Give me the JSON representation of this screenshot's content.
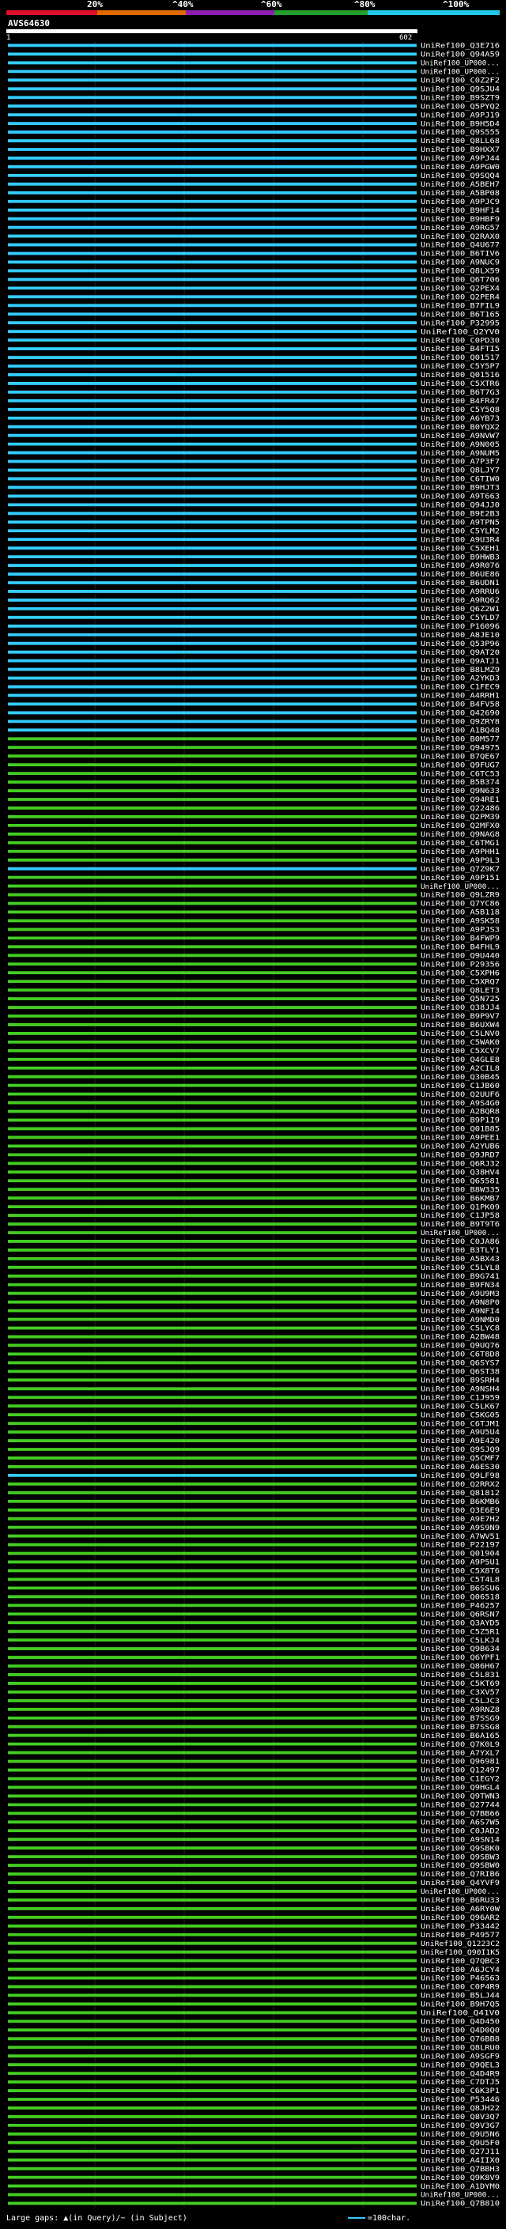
{
  "scale": {
    "labels": [
      "20%",
      "^40%",
      "^60%",
      "^80%",
      "^100%"
    ],
    "colors": [
      "#e0102a",
      "#e06a00",
      "#8a1fb0",
      "#22a02a",
      "#22c8e8"
    ]
  },
  "query": {
    "name": "AVS64630",
    "start": "1",
    "end": "602"
  },
  "colors": {
    "cyan": "#33ccff",
    "green": "#44cc22",
    "query_bar": "#ffffff"
  },
  "rows": [
    {
      "label": "UniRef100_Q3E716",
      "color": "cyan"
    },
    {
      "label": "UniRef100_Q94A59",
      "color": "cyan"
    },
    {
      "label": "UniRef100_UP000...",
      "color": "cyan"
    },
    {
      "label": "UniRef100_UP000...",
      "color": "cyan"
    },
    {
      "label": "UniRef100_C0Z2F2",
      "color": "cyan"
    },
    {
      "label": "UniRef100_Q9SJU4",
      "color": "cyan"
    },
    {
      "label": "UniRef100_B9SZT9",
      "color": "cyan"
    },
    {
      "label": "UniRef100_Q5PYQ2",
      "color": "cyan"
    },
    {
      "label": "UniRef100_A9PJ19",
      "color": "cyan"
    },
    {
      "label": "UniRef100_B9H5D4",
      "color": "cyan"
    },
    {
      "label": "UniRef100_Q9S555",
      "color": "cyan"
    },
    {
      "label": "UniRef100_Q8LL68",
      "color": "cyan"
    },
    {
      "label": "UniRef100_B9HXX7",
      "color": "cyan"
    },
    {
      "label": "UniRef100_A9PJ44",
      "color": "cyan"
    },
    {
      "label": "UniRef100_A9PGW0",
      "color": "cyan"
    },
    {
      "label": "UniRef100_Q9SQQ4",
      "color": "cyan"
    },
    {
      "label": "UniRef100_A5BEH7",
      "color": "cyan"
    },
    {
      "label": "UniRef100_A5BP08",
      "color": "cyan"
    },
    {
      "label": "UniRef100_A9PJC9",
      "color": "cyan"
    },
    {
      "label": "UniRef100_B9HF14",
      "color": "cyan"
    },
    {
      "label": "UniRef100_B9HBF9",
      "color": "cyan"
    },
    {
      "label": "UniRef100_A9RG57",
      "color": "cyan"
    },
    {
      "label": "UniRef100_Q2RAX0",
      "color": "cyan"
    },
    {
      "label": "UniRef100_Q4U677",
      "color": "cyan"
    },
    {
      "label": "UniRef100_B6TIV6",
      "color": "cyan"
    },
    {
      "label": "UniRef100_A9NUC9",
      "color": "cyan"
    },
    {
      "label": "UniRef100_Q8LX59",
      "color": "cyan"
    },
    {
      "label": "UniRef100_Q6T706",
      "color": "cyan"
    },
    {
      "label": "UniRef100_Q2PEX4",
      "color": "cyan"
    },
    {
      "label": "UniRef100_Q2PER4",
      "color": "cyan"
    },
    {
      "label": "UniRef100_B7FIL9",
      "color": "cyan"
    },
    {
      "label": "UniRef100_B6T165",
      "color": "cyan"
    },
    {
      "label": "UniRef100_P32995",
      "color": "cyan"
    },
    {
      "label": "UniRef100_Q2YV0",
      "color": "cyan"
    },
    {
      "label": "UniRef100_C0PD30",
      "color": "cyan"
    },
    {
      "label": "UniRef100_B4FTI5",
      "color": "cyan"
    },
    {
      "label": "UniRef100_Q01517",
      "color": "cyan"
    },
    {
      "label": "UniRef100_C5Y5P7",
      "color": "cyan"
    },
    {
      "label": "UniRef100_Q01516",
      "color": "cyan"
    },
    {
      "label": "UniRef100_C5XTR6",
      "color": "cyan"
    },
    {
      "label": "UniRef100_B6T7G3",
      "color": "cyan"
    },
    {
      "label": "UniRef100_B4FR47",
      "color": "cyan"
    },
    {
      "label": "UniRef100_C5Y5Q8",
      "color": "cyan"
    },
    {
      "label": "UniRef100_A6YB73",
      "color": "cyan"
    },
    {
      "label": "UniRef100_B0YQX2",
      "color": "cyan"
    },
    {
      "label": "UniRef100_A9NVW7",
      "color": "cyan"
    },
    {
      "label": "UniRef100_A9N005",
      "color": "cyan"
    },
    {
      "label": "UniRef100_A9NUM5",
      "color": "cyan"
    },
    {
      "label": "UniRef100_A7P3F7",
      "color": "cyan"
    },
    {
      "label": "UniRef100_Q8LJY7",
      "color": "cyan"
    },
    {
      "label": "UniRef100_C6TIW0",
      "color": "cyan"
    },
    {
      "label": "UniRef100_B9HJT3",
      "color": "cyan"
    },
    {
      "label": "UniRef100_A9T663",
      "color": "cyan"
    },
    {
      "label": "UniRef100_Q94JJ0",
      "color": "cyan"
    },
    {
      "label": "UniRef100_B9E2B3",
      "color": "cyan"
    },
    {
      "label": "UniRef100_A9TPN5",
      "color": "cyan"
    },
    {
      "label": "UniRef100_C5YLM2",
      "color": "cyan"
    },
    {
      "label": "UniRef100_A9U3R4",
      "color": "cyan"
    },
    {
      "label": "UniRef100_C5XEH1",
      "color": "cyan"
    },
    {
      "label": "UniRef100_B9HWB3",
      "color": "cyan"
    },
    {
      "label": "UniRef100_A9R076",
      "color": "cyan"
    },
    {
      "label": "UniRef100_B6UE86",
      "color": "cyan"
    },
    {
      "label": "UniRef100_B6UDN1",
      "color": "cyan"
    },
    {
      "label": "UniRef100_A9RRU6",
      "color": "cyan"
    },
    {
      "label": "UniRef100_A9RQ62",
      "color": "cyan"
    },
    {
      "label": "UniRef100_Q6Z2W1",
      "color": "cyan"
    },
    {
      "label": "UniRef100_C5YLD7",
      "color": "cyan"
    },
    {
      "label": "UniRef100_P16096",
      "color": "cyan"
    },
    {
      "label": "UniRef100_A8JE10",
      "color": "cyan"
    },
    {
      "label": "UniRef100_Q53P96",
      "color": "cyan"
    },
    {
      "label": "UniRef100_Q9AT20",
      "color": "cyan"
    },
    {
      "label": "UniRef100_Q9ATJ1",
      "color": "cyan"
    },
    {
      "label": "UniRef100_B8LMZ9",
      "color": "cyan"
    },
    {
      "label": "UniRef100_A2YKD3",
      "color": "cyan"
    },
    {
      "label": "UniRef100_C1FEC9",
      "color": "cyan"
    },
    {
      "label": "UniRef100_A4RRH1",
      "color": "cyan"
    },
    {
      "label": "UniRef100_B4FV58",
      "color": "cyan"
    },
    {
      "label": "UniRef100_Q42690",
      "color": "cyan"
    },
    {
      "label": "UniRef100_Q9ZRY8",
      "color": "cyan"
    },
    {
      "label": "UniRef100_A1BQ48",
      "color": "cyan"
    },
    {
      "label": "UniRef100_B0M577",
      "color": "green"
    },
    {
      "label": "UniRef100_Q94975",
      "color": "green"
    },
    {
      "label": "UniRef100_B7QE67",
      "color": "green"
    },
    {
      "label": "UniRef100_Q9FUG7",
      "color": "green"
    },
    {
      "label": "UniRef100_C6TC53",
      "color": "green"
    },
    {
      "label": "UniRef100_B5B374",
      "color": "green"
    },
    {
      "label": "UniRef100_Q9N633",
      "color": "green"
    },
    {
      "label": "UniRef100_Q94RE1",
      "color": "green"
    },
    {
      "label": "UniRef100_Q22486",
      "color": "green"
    },
    {
      "label": "UniRef100_Q2PM39",
      "color": "green"
    },
    {
      "label": "UniRef100_Q2MFX0",
      "color": "green"
    },
    {
      "label": "UniRef100_Q9NAG8",
      "color": "green"
    },
    {
      "label": "UniRef100_C6TMG1",
      "color": "green"
    },
    {
      "label": "UniRef100_A9PHH1",
      "color": "green"
    },
    {
      "label": "UniRef100_A9P9L3",
      "color": "green"
    },
    {
      "label": "UniRef100_Q7Z9K7",
      "color": "cyan"
    },
    {
      "label": "UniRef100_A9P151",
      "color": "green"
    },
    {
      "label": "UniRef100_UP000...",
      "color": "green"
    },
    {
      "label": "UniRef100_Q9LZR9",
      "color": "green"
    },
    {
      "label": "UniRef100_Q7YC86",
      "color": "green"
    },
    {
      "label": "UniRef100_A5B118",
      "color": "green"
    },
    {
      "label": "UniRef100_A9SK58",
      "color": "green"
    },
    {
      "label": "UniRef100_A9PJS3",
      "color": "green"
    },
    {
      "label": "UniRef100_B4FWP9",
      "color": "green"
    },
    {
      "label": "UniRef100_B4FHL9",
      "color": "green"
    },
    {
      "label": "UniRef100_Q9U440",
      "color": "green"
    },
    {
      "label": "UniRef100_P29356",
      "color": "green"
    },
    {
      "label": "UniRef100_C5XPH6",
      "color": "green"
    },
    {
      "label": "UniRef100_C5XRQ7",
      "color": "green"
    },
    {
      "label": "UniRef100_Q8LET3",
      "color": "green"
    },
    {
      "label": "UniRef100_Q5N725",
      "color": "green"
    },
    {
      "label": "UniRef100_Q38JJ4",
      "color": "green"
    },
    {
      "label": "UniRef100_B9P9V7",
      "color": "green"
    },
    {
      "label": "UniRef100_B6UXW4",
      "color": "green"
    },
    {
      "label": "UniRef100_C5LNV0",
      "color": "green"
    },
    {
      "label": "UniRef100_C5WAK0",
      "color": "green"
    },
    {
      "label": "UniRef100_C5XCV7",
      "color": "green"
    },
    {
      "label": "UniRef100_Q4GLE8",
      "color": "green"
    },
    {
      "label": "UniRef100_A2CIL8",
      "color": "green"
    },
    {
      "label": "UniRef100_Q30B45",
      "color": "green"
    },
    {
      "label": "UniRef100_C1JB60",
      "color": "green"
    },
    {
      "label": "UniRef100_Q2UUF6",
      "color": "green"
    },
    {
      "label": "UniRef100_A9S4G0",
      "color": "green"
    },
    {
      "label": "UniRef100_A2BQR8",
      "color": "green"
    },
    {
      "label": "UniRef100_B9P1I9",
      "color": "green"
    },
    {
      "label": "UniRef100_Q01B85",
      "color": "green"
    },
    {
      "label": "UniRef100_A9PEE1",
      "color": "green"
    },
    {
      "label": "UniRef100_A2YUB6",
      "color": "green"
    },
    {
      "label": "UniRef100_Q9JRD7",
      "color": "green"
    },
    {
      "label": "UniRef100_Q6RJ32",
      "color": "green"
    },
    {
      "label": "UniRef100_Q38HV4",
      "color": "green"
    },
    {
      "label": "UniRef100_Q65581",
      "color": "green"
    },
    {
      "label": "UniRef100_B8W335",
      "color": "green"
    },
    {
      "label": "UniRef100_B6KMB7",
      "color": "green"
    },
    {
      "label": "UniRef100_Q1PK09",
      "color": "green"
    },
    {
      "label": "UniRef100_C1JP58",
      "color": "green"
    },
    {
      "label": "UniRef100_B9T9T6",
      "color": "green"
    },
    {
      "label": "UniRef100_UP000...",
      "color": "green"
    },
    {
      "label": "UniRef100_C0JA86",
      "color": "green"
    },
    {
      "label": "UniRef100_B3TLY1",
      "color": "green"
    },
    {
      "label": "UniRef100_A5BX43",
      "color": "green"
    },
    {
      "label": "UniRef100_C5LYL8",
      "color": "green"
    },
    {
      "label": "UniRef100_B9G741",
      "color": "green"
    },
    {
      "label": "UniRef100_B9FN34",
      "color": "green"
    },
    {
      "label": "UniRef100_A9U9M3",
      "color": "green"
    },
    {
      "label": "UniRef100_A9N8P0",
      "color": "green"
    },
    {
      "label": "UniRef100_A9NFI4",
      "color": "green"
    },
    {
      "label": "UniRef100_A9NMD0",
      "color": "green"
    },
    {
      "label": "UniRef100_C5LYC8",
      "color": "green"
    },
    {
      "label": "UniRef100_A2BW48",
      "color": "green"
    },
    {
      "label": "UniRef100_Q9UQ76",
      "color": "green"
    },
    {
      "label": "UniRef100_C6T8D8",
      "color": "green"
    },
    {
      "label": "UniRef100_Q6SYS7",
      "color": "green"
    },
    {
      "label": "UniRef100_Q6ST38",
      "color": "green"
    },
    {
      "label": "UniRef100_B9SRH4",
      "color": "green"
    },
    {
      "label": "UniRef100_A9NSH4",
      "color": "green"
    },
    {
      "label": "UniRef100_C1J959",
      "color": "green"
    },
    {
      "label": "UniRef100_C5LK67",
      "color": "green"
    },
    {
      "label": "UniRef100_C5KG05",
      "color": "green"
    },
    {
      "label": "UniRef100_C6TJM1",
      "color": "green"
    },
    {
      "label": "UniRef100_A9U5U4",
      "color": "green"
    },
    {
      "label": "UniRef100_A9E420",
      "color": "green"
    },
    {
      "label": "UniRef100_Q9SJQ9",
      "color": "green"
    },
    {
      "label": "UniRef100_Q5CMF7",
      "color": "green"
    },
    {
      "label": "UniRef100_A6ES30",
      "color": "green"
    },
    {
      "label": "UniRef100_Q9LF98",
      "color": "cyan"
    },
    {
      "label": "UniRef100_Q2RRX2",
      "color": "green"
    },
    {
      "label": "UniRef100_Q81812",
      "color": "green"
    },
    {
      "label": "UniRef100_B6KMB6",
      "color": "green"
    },
    {
      "label": "UniRef100_Q3E6E9",
      "color": "green"
    },
    {
      "label": "UniRef100_A9E7H2",
      "color": "green"
    },
    {
      "label": "UniRef100_A9S9N9",
      "color": "green"
    },
    {
      "label": "UniRef100_A7WV51",
      "color": "green"
    },
    {
      "label": "UniRef100_P22197",
      "color": "green"
    },
    {
      "label": "UniRef100_Q01904",
      "color": "green"
    },
    {
      "label": "UniRef100_A9P5U1",
      "color": "green"
    },
    {
      "label": "UniRef100_C5X8T6",
      "color": "green"
    },
    {
      "label": "UniRef100_C5T4L8",
      "color": "green"
    },
    {
      "label": "UniRef100_B6SSU6",
      "color": "green"
    },
    {
      "label": "UniRef100_Q06518",
      "color": "green"
    },
    {
      "label": "UniRef100_P46257",
      "color": "green"
    },
    {
      "label": "UniRef100_Q6RSN7",
      "color": "green"
    },
    {
      "label": "UniRef100_Q3AYD5",
      "color": "green"
    },
    {
      "label": "UniRef100_C5Z5R1",
      "color": "green"
    },
    {
      "label": "UniRef100_C5LKJ4",
      "color": "green"
    },
    {
      "label": "UniRef100_Q9B634",
      "color": "green"
    },
    {
      "label": "UniRef100_Q6YPF1",
      "color": "green"
    },
    {
      "label": "UniRef100_Q86H67",
      "color": "green"
    },
    {
      "label": "UniRef100_C5L831",
      "color": "green"
    },
    {
      "label": "UniRef100_C5KT69",
      "color": "green"
    },
    {
      "label": "UniRef100_C3XV57",
      "color": "green"
    },
    {
      "label": "UniRef100_C5LJC3",
      "color": "green"
    },
    {
      "label": "UniRef100_A9RNZ8",
      "color": "green"
    },
    {
      "label": "UniRef100_B7SSG9",
      "color": "green"
    },
    {
      "label": "UniRef100_B7SSG8",
      "color": "green"
    },
    {
      "label": "UniRef100_B6A165",
      "color": "green"
    },
    {
      "label": "UniRef100_Q7K0L9",
      "color": "green"
    },
    {
      "label": "UniRef100_A7YXL7",
      "color": "green"
    },
    {
      "label": "UniRef100_Q96981",
      "color": "green"
    },
    {
      "label": "UniRef100_Q12497",
      "color": "green"
    },
    {
      "label": "UniRef100_C1EGY2",
      "color": "green"
    },
    {
      "label": "UniRef100_Q9HGL4",
      "color": "green"
    },
    {
      "label": "UniRef100_Q9TWN3",
      "color": "green"
    },
    {
      "label": "UniRef100_Q27744",
      "color": "green"
    },
    {
      "label": "UniRef100_Q7BB66",
      "color": "green"
    },
    {
      "label": "UniRef100_A6S7W5",
      "color": "green"
    },
    {
      "label": "UniRef100_C0JAD2",
      "color": "green"
    },
    {
      "label": "UniRef100_A9SN14",
      "color": "green"
    },
    {
      "label": "UniRef100_Q9SBK0",
      "color": "green"
    },
    {
      "label": "UniRef100_Q9SBW3",
      "color": "green"
    },
    {
      "label": "UniRef100_Q9SBW0",
      "color": "green"
    },
    {
      "label": "UniRef100_Q7RIB6",
      "color": "green"
    },
    {
      "label": "UniRef100_Q4YVF9",
      "color": "green"
    },
    {
      "label": "UniRef100_UP000...",
      "color": "green"
    },
    {
      "label": "UniRef100_B6RU33",
      "color": "green"
    },
    {
      "label": "UniRef100_A6RY0W",
      "color": "green"
    },
    {
      "label": "UniRef100_Q96AR2",
      "color": "green"
    },
    {
      "label": "UniRef100_P33442",
      "color": "green"
    },
    {
      "label": "UniRef100_P49577",
      "color": "green"
    },
    {
      "label": "UniRef100_Q1223C2",
      "color": "green"
    },
    {
      "label": "UniRef100_Q90I1K5",
      "color": "green"
    },
    {
      "label": "UniRef100_Q7QBC3",
      "color": "green"
    },
    {
      "label": "UniRef100_A6JCY4",
      "color": "green"
    },
    {
      "label": "UniRef100_P46563",
      "color": "green"
    },
    {
      "label": "UniRef100_C0P4R9",
      "color": "green"
    },
    {
      "label": "UniRef100_B5LJ44",
      "color": "green"
    },
    {
      "label": "UniRef100_B9H7Q5",
      "color": "green"
    },
    {
      "label": "UniRef100_Q41V0",
      "color": "green"
    },
    {
      "label": "UniRef100_Q4D450",
      "color": "green"
    },
    {
      "label": "UniRef100_Q4D0Q0",
      "color": "green"
    },
    {
      "label": "UniRef100_Q76BB8",
      "color": "green"
    },
    {
      "label": "UniRef100_Q8LRU0",
      "color": "green"
    },
    {
      "label": "UniRef100_A9SGF9",
      "color": "green"
    },
    {
      "label": "UniRef100_Q9QEL3",
      "color": "green"
    },
    {
      "label": "UniRef100_Q4D4R9",
      "color": "green"
    },
    {
      "label": "UniRef100_C7DTJ5",
      "color": "green"
    },
    {
      "label": "UniRef100_C6K3P1",
      "color": "green"
    },
    {
      "label": "UniRef100_P53446",
      "color": "green"
    },
    {
      "label": "UniRef100_Q8JH22",
      "color": "green"
    },
    {
      "label": "UniRef100_Q8V3Q7",
      "color": "green"
    },
    {
      "label": "UniRef100_Q9V3G7",
      "color": "green"
    },
    {
      "label": "UniRef100_Q9U5N6",
      "color": "green"
    },
    {
      "label": "UniRef100_Q9U5F0",
      "color": "green"
    },
    {
      "label": "UniRef100_Q27J11",
      "color": "green"
    },
    {
      "label": "UniRef100_A4IIX0",
      "color": "green"
    },
    {
      "label": "UniRef100_Q7BBH3",
      "color": "green"
    },
    {
      "label": "UniRef100_Q9K8V9",
      "color": "green"
    },
    {
      "label": "UniRef100_A1DYM0",
      "color": "green"
    },
    {
      "label": "UniRef100_UP000...",
      "color": "green"
    },
    {
      "label": "UniRef100_Q7B810",
      "color": "green"
    }
  ],
  "legend": {
    "large_gaps": "Large gaps: ▲(in Query)/~ (in Subject)",
    "scale_note": "=100char."
  }
}
